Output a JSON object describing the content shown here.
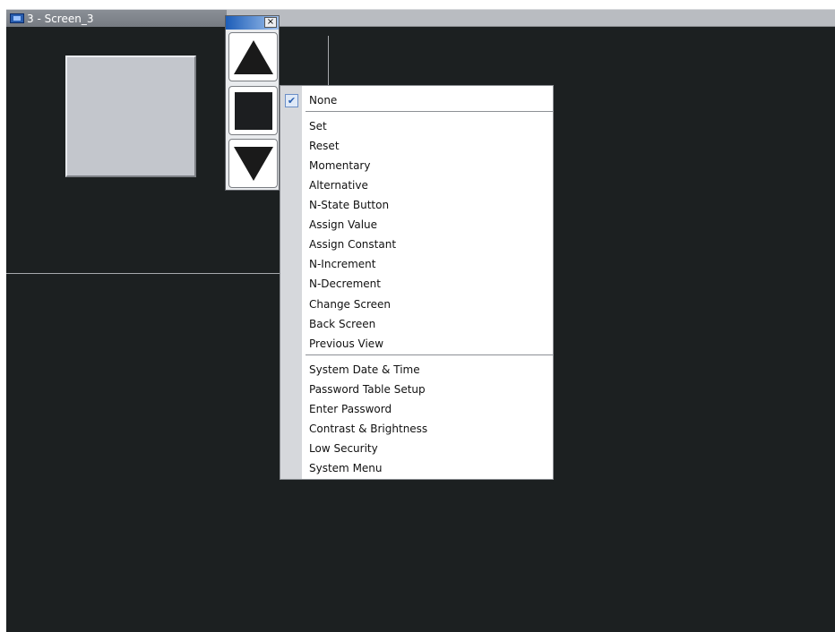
{
  "window": {
    "title": "3 - Screen_3",
    "close_glyph": "×"
  },
  "toolbar": {
    "buttons": [
      {
        "icon": "triangle-up-icon"
      },
      {
        "icon": "square-icon"
      },
      {
        "icon": "triangle-down-icon"
      }
    ]
  },
  "menu": {
    "checked": "None",
    "check_glyph": "✔",
    "items": [
      "None",
      "Set",
      "Reset",
      "Momentary",
      "Alternative",
      "N-State Button",
      "Assign Value",
      "Assign Constant",
      "N-Increment",
      "N-Decrement",
      "Change Screen",
      "Back Screen",
      "Previous View",
      "System Date & Time",
      "Password Table Setup",
      "Enter Password",
      "Contrast & Brightness",
      "Low Security",
      "System Menu"
    ]
  }
}
